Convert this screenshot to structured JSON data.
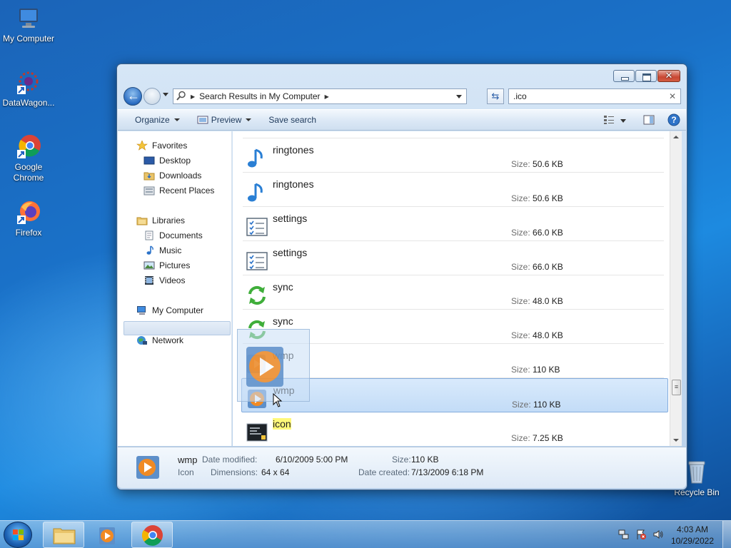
{
  "desktop": {
    "icons": [
      {
        "label": "My Computer"
      },
      {
        "label": "DataWagon..."
      },
      {
        "label": "Google Chrome"
      },
      {
        "label": "Firefox"
      },
      {
        "label": "Recycle Bin"
      }
    ]
  },
  "window": {
    "address": {
      "path": "Search Results in My Computer"
    },
    "search": {
      "value": ".ico"
    },
    "toolbar": {
      "organize": "Organize",
      "preview": "Preview",
      "save_search": "Save search"
    }
  },
  "navpane": {
    "favorites": "Favorites",
    "desktop": "Desktop",
    "downloads": "Downloads",
    "recent_places": "Recent Places",
    "libraries": "Libraries",
    "documents": "Documents",
    "music": "Music",
    "pictures": "Pictures",
    "videos": "Videos",
    "my_computer": "My Computer",
    "network": "Network"
  },
  "files": {
    "size_label": "Size:",
    "rows": [
      {
        "name": "ringtones",
        "size": "50.6 KB",
        "icon": "music-note-icon"
      },
      {
        "name": "ringtones",
        "size": "50.6 KB",
        "icon": "music-note-icon"
      },
      {
        "name": "settings",
        "size": "66.0 KB",
        "icon": "checklist-icon"
      },
      {
        "name": "settings",
        "size": "66.0 KB",
        "icon": "checklist-icon"
      },
      {
        "name": "sync",
        "size": "48.0 KB",
        "icon": "sync-arrows-icon"
      },
      {
        "name": "sync",
        "size": "48.0 KB",
        "icon": "sync-arrows-icon"
      },
      {
        "name": "wmp",
        "size": "110 KB",
        "icon": "media-player-icon"
      },
      {
        "name": "wmp",
        "size": "110 KB",
        "icon": "media-player-icon"
      },
      {
        "name": "icon",
        "size": "7.25 KB",
        "icon": "terminal-icon"
      }
    ]
  },
  "details": {
    "name": "wmp",
    "type": "Icon",
    "date_modified_label": "Date modified:",
    "date_modified": "6/10/2009 5:00 PM",
    "dimensions_label": "Dimensions:",
    "dimensions": "64 x 64",
    "size_label": "Size:",
    "size": "110 KB",
    "date_created_label": "Date created:",
    "date_created": "7/13/2009 6:18 PM"
  },
  "taskbar": {
    "time": "4:03 AM",
    "date": "10/29/2022"
  },
  "colors": {
    "selection": "#cfe3fa",
    "highlight": "#fff87a",
    "accent": "#1d6fc4"
  }
}
